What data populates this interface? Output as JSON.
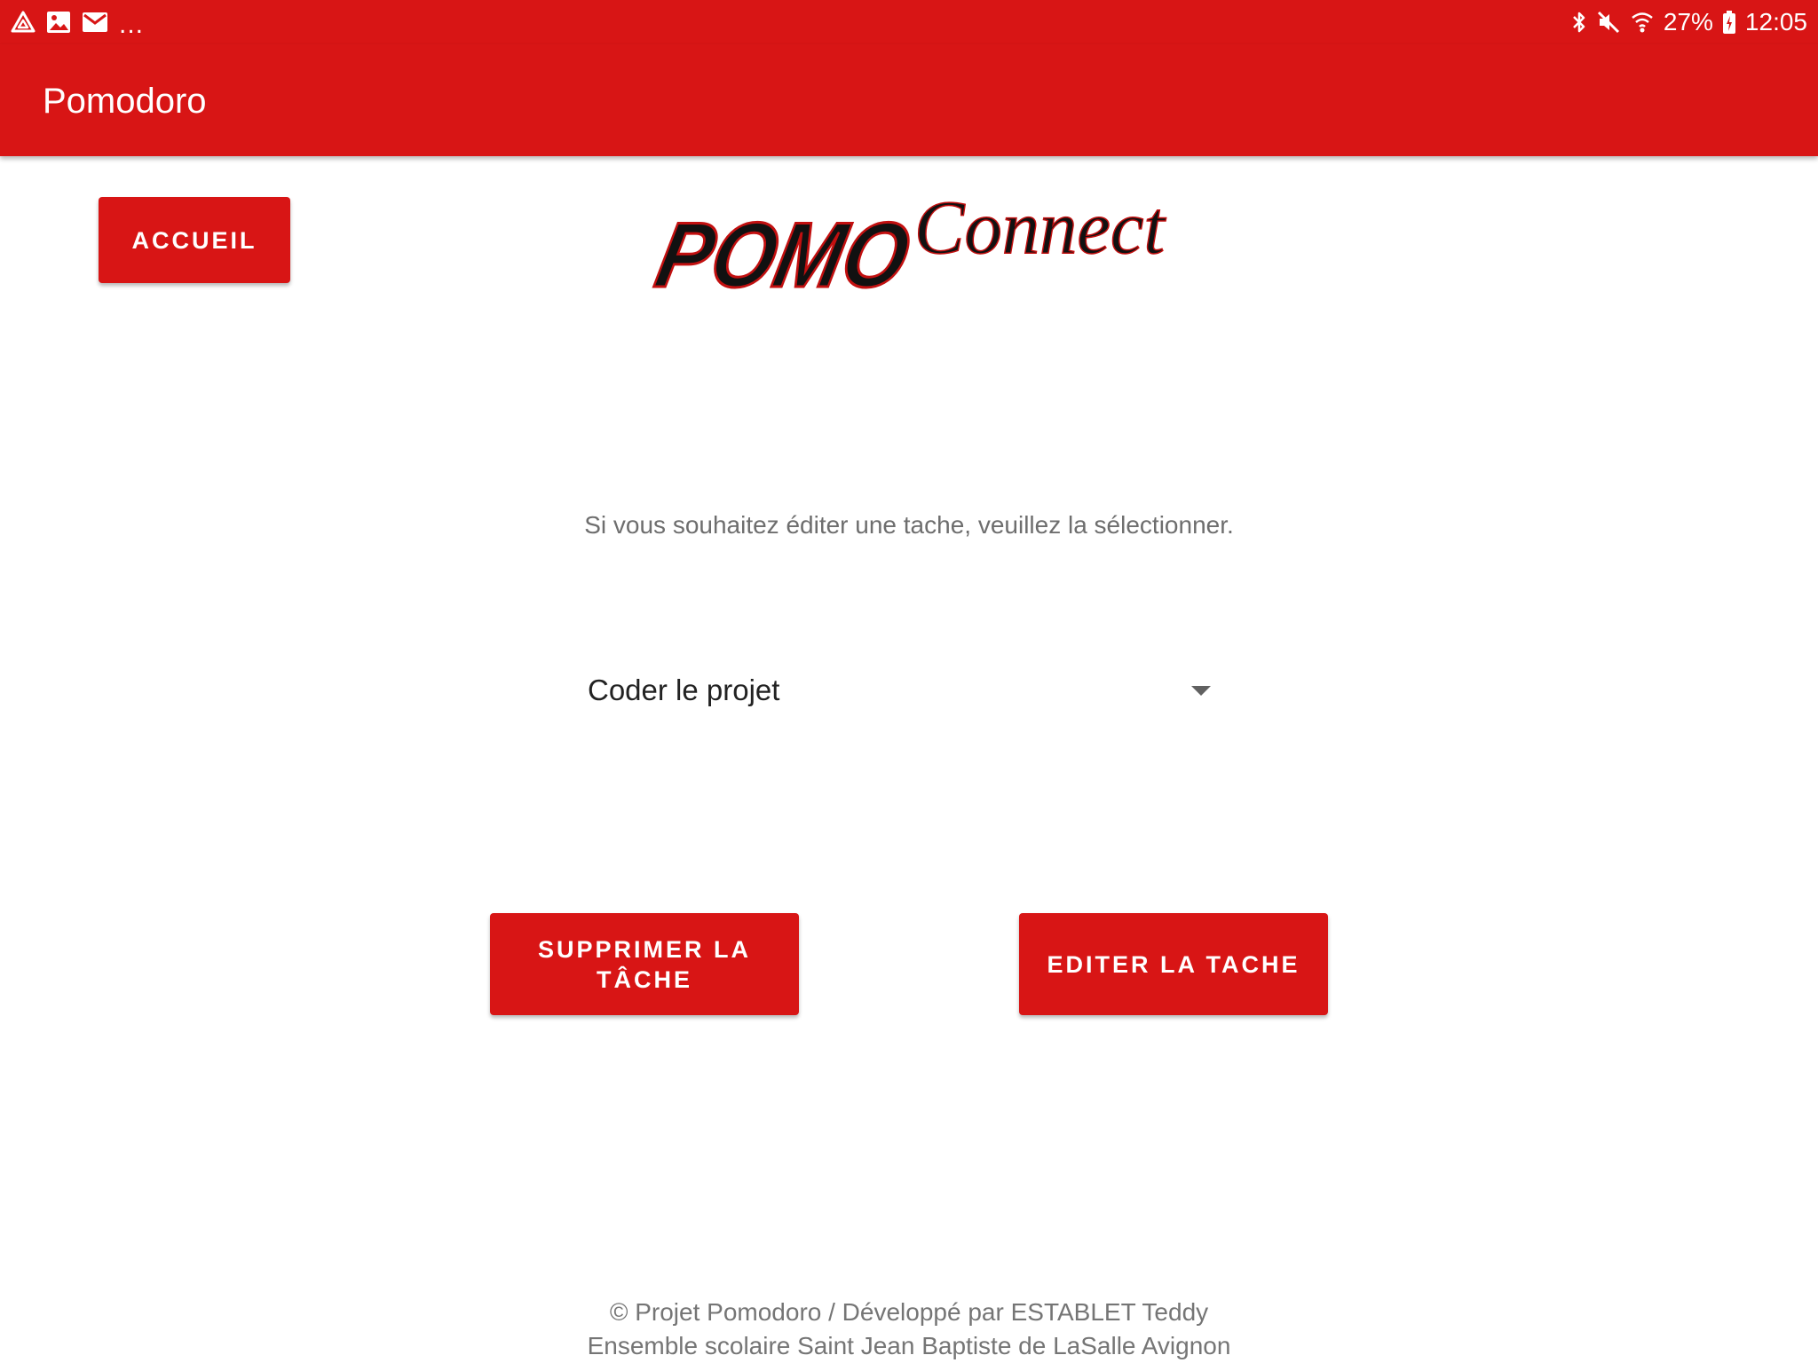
{
  "status_bar": {
    "left_icons": [
      "drive-icon",
      "image-icon",
      "mail-icon"
    ],
    "overflow": "...",
    "right_icons": [
      "bluetooth-icon",
      "mute-icon",
      "wifi-icon",
      "battery-icon"
    ],
    "battery": "27%",
    "time": "12:05"
  },
  "app_bar": {
    "title": "Pomodoro"
  },
  "home_button": {
    "label": "ACCUEIL"
  },
  "logo": {
    "text_a": "POMO",
    "text_b": "Connect"
  },
  "main": {
    "instruction": "Si vous souhaitez éditer une tache, veuillez la sélectionner.",
    "task_select": {
      "selected": "Coder le projet"
    },
    "delete_button": {
      "line1": "SUPPRIMER LA",
      "line2": "TÂCHE"
    },
    "edit_button": {
      "label": "EDITER LA TACHE"
    }
  },
  "footer": {
    "line1": "© Projet Pomodoro / Développé par ESTABLET Teddy",
    "line2": "Ensemble scolaire Saint Jean Baptiste de LaSalle Avignon"
  },
  "colors": {
    "primary": "#d81515",
    "on_primary": "#ffffff",
    "secondary_text": "#757575"
  }
}
